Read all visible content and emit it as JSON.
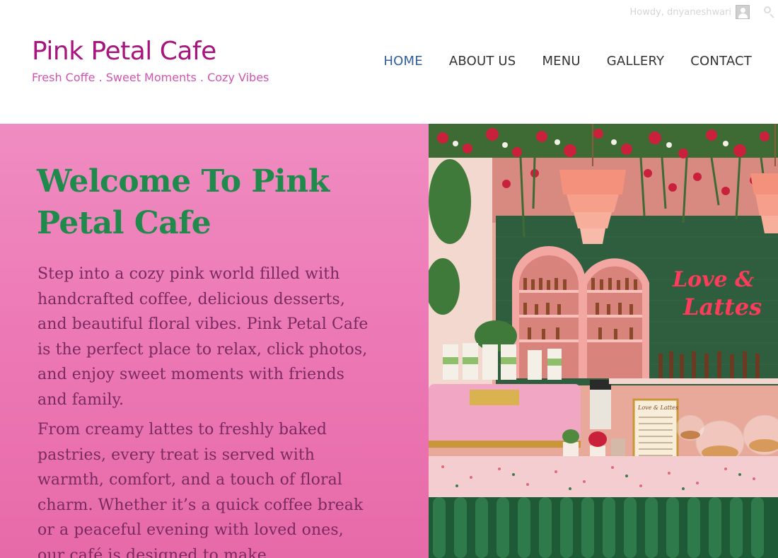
{
  "admin_bar": {
    "greeting": "Howdy, dnyaneshwari",
    "avatar_icon": "user-avatar-icon",
    "search_icon": "search-icon"
  },
  "site": {
    "title": "Pink Petal Cafe",
    "tagline": "Fresh Coffe . Sweet Moments . Cozy Vibes"
  },
  "nav": {
    "items": [
      {
        "label": "HOME",
        "active": true
      },
      {
        "label": "ABOUT US",
        "active": false
      },
      {
        "label": "MENU",
        "active": false
      },
      {
        "label": "GALLERY",
        "active": false
      },
      {
        "label": "CONTACT",
        "active": false
      }
    ]
  },
  "hero": {
    "heading": "Welcome To Pink Petal Cafe",
    "paragraph_1": "Step into a cozy pink world filled with handcrafted coffee, delicious desserts, and beautiful floral vibes. Pink Petal Cafe is the perfect place to relax, click photos, and enjoy sweet moments with friends and family.",
    "paragraph_2": "From creamy lattes to freshly baked pastries, every treat is served with warmth, comfort, and a touch of floral charm. Whether it’s a quick coffee break or a peaceful evening with loved ones, our café is designed to make",
    "image": {
      "neon_sign_line_1": "Love &",
      "neon_sign_line_2": "Lattes",
      "menu_board_title": "Love & Lattes"
    }
  },
  "colors": {
    "brand": "#a8147e",
    "tagline": "#d154b0",
    "nav_active": "#2f5f9c",
    "hero_bg": "#ec78b5",
    "heading_green": "#1f8a4c",
    "body_text": "#7a2a62"
  }
}
